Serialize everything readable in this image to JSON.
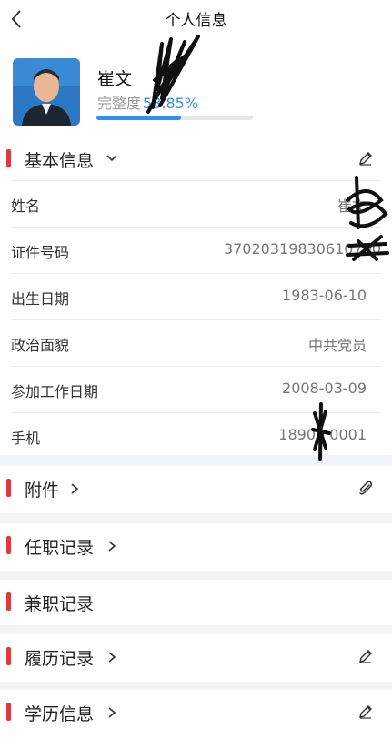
{
  "nav": {
    "title": "个人信息",
    "back_icon": "chevron-left-icon"
  },
  "profile": {
    "name": "崔文",
    "completion_label": "完整度",
    "completion_percent": "53.85%",
    "completion_fraction": 0.5385
  },
  "basic_info": {
    "title": "基本信息",
    "rows": [
      {
        "label": "姓名",
        "value": "崔文"
      },
      {
        "label": "证件号码",
        "value": "37020319830610700"
      },
      {
        "label": "出生日期",
        "value": "1983-06-10"
      },
      {
        "label": "政治面貌",
        "value": "中共党员"
      },
      {
        "label": "参加工作日期",
        "value": "2008-03-09"
      },
      {
        "label": "手机",
        "value": "18906 0001"
      }
    ]
  },
  "sections": {
    "attachments": "附件",
    "positions": "任职记录",
    "part_time": "兼职记录",
    "resume": "履历记录",
    "education": "学历信息"
  },
  "colors": {
    "accent_red": "#e0393e",
    "accent_blue": "#2f8ff0"
  }
}
